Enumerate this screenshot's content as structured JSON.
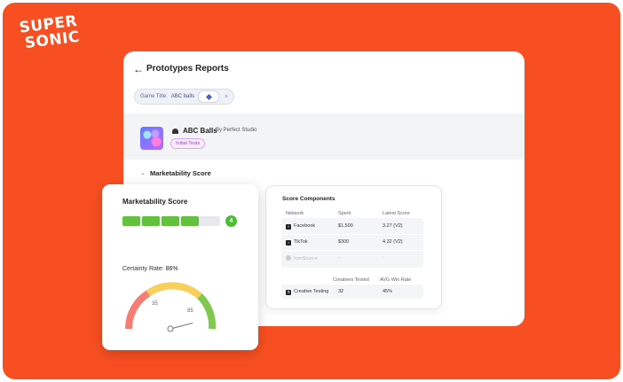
{
  "brand": {
    "line1": "SUPER",
    "line2": "SONIC"
  },
  "report": {
    "back_icon": "arrow-left-icon",
    "title": "Prototypes Reports",
    "filter": {
      "label": "Game Title:",
      "value": "ABC balls",
      "remove_label": "×"
    },
    "game": {
      "name": "ABC Balls",
      "studio": "By Perfect Studio",
      "tag": "Initial Tests",
      "platform_icon": "android-icon"
    },
    "section": {
      "chevron": "⌄",
      "title": "Marketability Score"
    }
  },
  "score_components": {
    "title": "Score Components",
    "headers": {
      "network": "Network",
      "spent": "Spent",
      "latest_score": "Latest Score"
    },
    "rows": [
      {
        "network": "Facebook",
        "icon": "facebook-icon",
        "spent": "$1,500",
        "latest_score": "3.27 (V2)"
      },
      {
        "network": "TikTok",
        "icon": "tiktok-icon",
        "spent": "$300",
        "latest_score": "4.32 (V2)"
      },
      {
        "network": "IronSource",
        "icon": "ironsource-icon",
        "spent": "-",
        "latest_score": "-"
      }
    ],
    "headers2": {
      "creatives_tested": "Creatives Tested",
      "avg_win_rate": "AVG Win Rate"
    },
    "row2": {
      "label": "Creative Testing",
      "icon": "flask-icon",
      "creatives_tested": "32",
      "avg_win_rate": "45%"
    }
  },
  "marketability": {
    "title": "Marketability Score",
    "score": "4",
    "bar_segments_filled": 4,
    "bar_segments_total": 5,
    "certainty_label": "Certainty Rate:",
    "certainty_value": "86%",
    "gauge": {
      "label_low": "35",
      "label_high": "85",
      "value_fraction": 0.86
    },
    "colors": {
      "bar_fill": "#62c23e",
      "badge": "#4cbc37",
      "gauge_red": "#f47e74",
      "gauge_yellow": "#f8cf5a",
      "gauge_green": "#7fc94f"
    }
  },
  "colors": {
    "background": "#f74f22"
  }
}
